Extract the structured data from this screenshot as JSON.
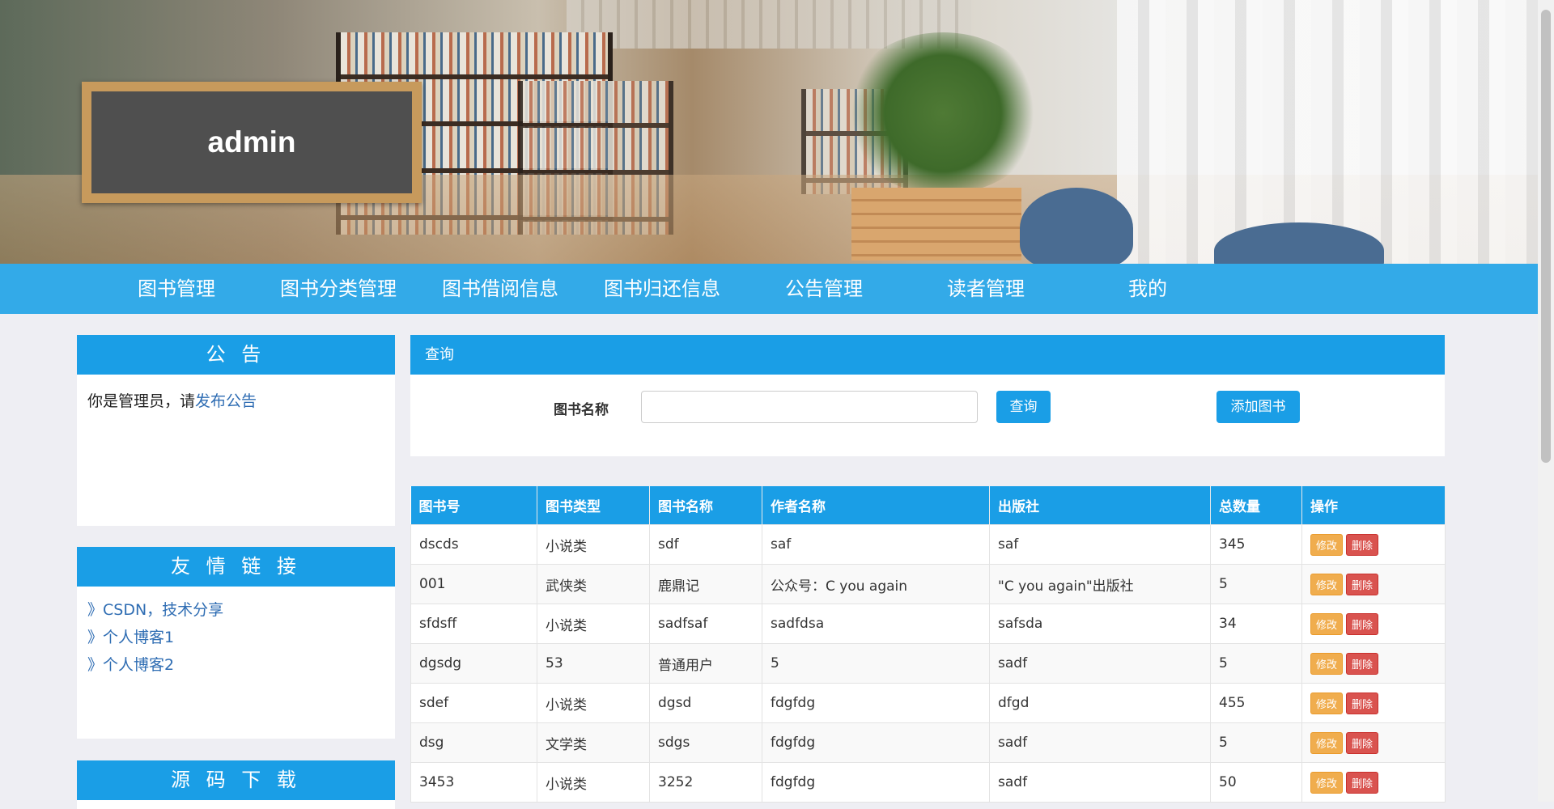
{
  "header": {
    "username": "admin"
  },
  "nav": {
    "items": [
      {
        "label": "图书管理"
      },
      {
        "label": "图书分类管理"
      },
      {
        "label": "图书借阅信息"
      },
      {
        "label": "图书归还信息"
      },
      {
        "label": "公告管理"
      },
      {
        "label": "读者管理"
      },
      {
        "label": "我的"
      }
    ]
  },
  "notice": {
    "title": "公 告",
    "text": "你是管理员，请",
    "link": "发布公告"
  },
  "friends": {
    "title": "友 情 链 接",
    "links": [
      "》CSDN，技术分享",
      "》个人博客1",
      "》个人博客2"
    ]
  },
  "download": {
    "title": "源 码 下 载"
  },
  "query": {
    "title": "查询",
    "label": "图书名称",
    "input_value": "",
    "search_label": "查询",
    "add_label": "添加图书"
  },
  "table": {
    "headers": [
      "图书号",
      "图书类型",
      "图书名称",
      "作者名称",
      "出版社",
      "总数量",
      "操作"
    ],
    "edit_label": "修改",
    "delete_label": "删除",
    "rows": [
      [
        "dscds",
        "小说类",
        "sdf",
        "saf",
        "saf",
        "345"
      ],
      [
        "001",
        "武侠类",
        "鹿鼎记",
        "公众号：C you again",
        "\"C you again\"出版社",
        "5"
      ],
      [
        "sfdsff",
        "小说类",
        "sadfsaf",
        "sadfdsa",
        "safsda",
        "34"
      ],
      [
        "dgsdg",
        "53",
        "普通用户",
        "5",
        "sadf",
        "5"
      ],
      [
        "sdef",
        "小说类",
        "dgsd",
        "fdgfdg",
        "dfgd",
        "455"
      ],
      [
        "dsg",
        "文学类",
        "sdgs",
        "fdgfdg",
        "sadf",
        "5"
      ],
      [
        "3453",
        "小说类",
        "3252",
        "fdgfdg",
        "sadf",
        "50"
      ]
    ]
  },
  "colors": {
    "accent": "#1a9ee6",
    "edit": "#f0ad4e",
    "delete": "#d9534f"
  }
}
